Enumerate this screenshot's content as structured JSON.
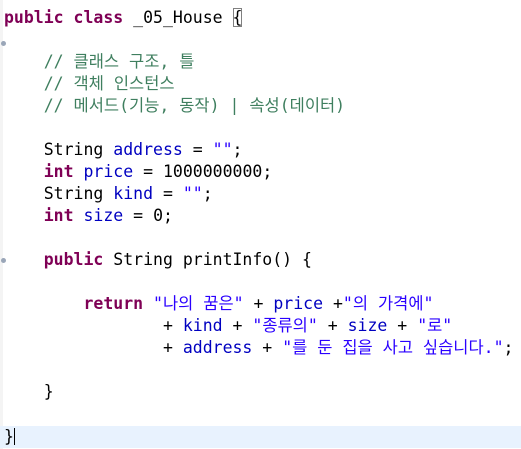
{
  "editor": {
    "lines": {
      "l1": {
        "kw1": "public",
        "kw2": "class",
        "name": "_05_House",
        "brace": "{"
      },
      "l3": {
        "text": "// 클래스 구조, 틀"
      },
      "l4": {
        "text": "// 객체 인스턴스"
      },
      "l5": {
        "text": "// 메서드(기능, 동작) | 속성(데이터)"
      },
      "l7": {
        "type": "String",
        "field": "address",
        "op": " = ",
        "val": "\"\"",
        "end": ";"
      },
      "l8": {
        "type": "int",
        "field": "price",
        "op": " = ",
        "val": "1000000000",
        "end": ";"
      },
      "l9": {
        "type": "String",
        "field": "kind",
        "op": " = ",
        "val": "\"\"",
        "end": ";"
      },
      "l10": {
        "type": "int",
        "field": "size",
        "op": " = ",
        "val": "0",
        "end": ";"
      },
      "l12": {
        "kw": "public",
        "sig": " String printInfo() {"
      },
      "l14": {
        "kw": "return",
        "s1": "\"나의 꿈은\"",
        "t1": " + ",
        "f1": "price",
        "t2": " +",
        "s2": "\"의 가격에\""
      },
      "l15": {
        "t1": "+ ",
        "f1": "kind",
        "t2": " + ",
        "s1": "\"종류의\"",
        "t3": " + ",
        "f2": "size",
        "t4": " + ",
        "s2": "\"로\""
      },
      "l16": {
        "t1": "+ ",
        "f1": "address",
        "t2": " + ",
        "s1": "\"를 둔 집을 사고 싶습니다.\"",
        "t3": ";"
      },
      "l18": {
        "text": "}"
      },
      "l20": {
        "text": "}"
      }
    }
  }
}
